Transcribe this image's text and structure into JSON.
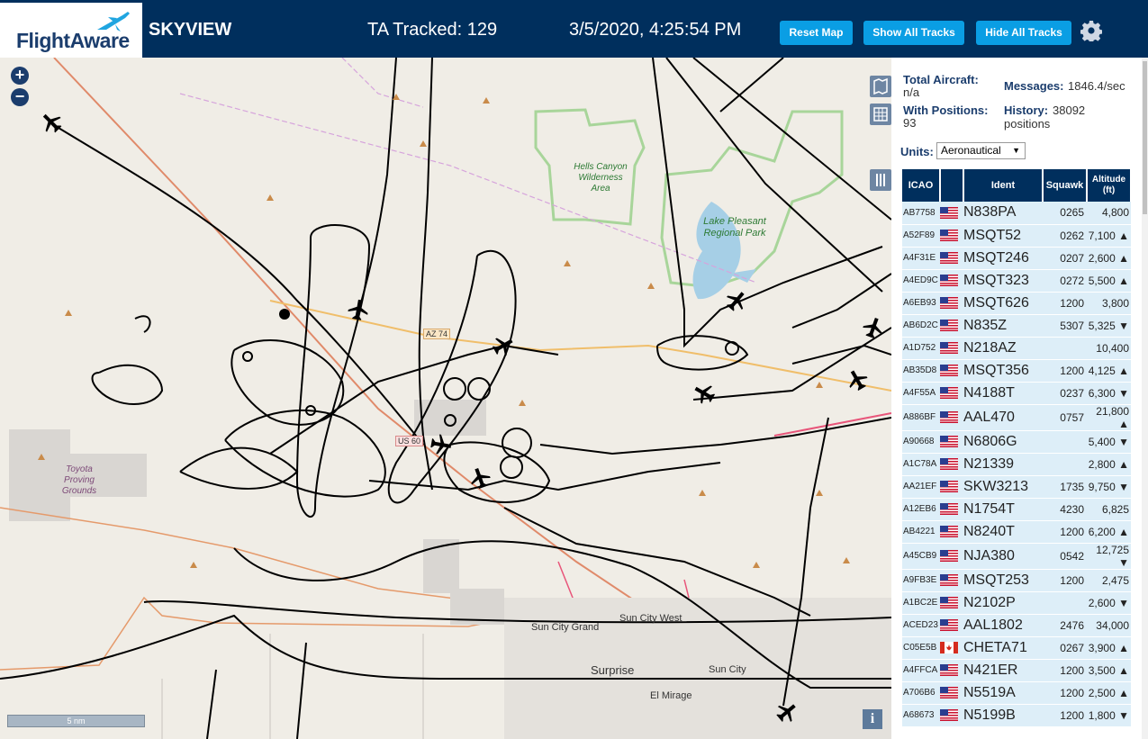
{
  "header": {
    "logo_text": "FlightAware",
    "app_title": "SKYVIEW",
    "ta_tracked": "TA Tracked: 129",
    "clock": "3/5/2020, 4:25:54 PM",
    "buttons": {
      "reset": "Reset Map",
      "show_all": "Show All Tracks",
      "hide_all": "Hide All Tracks"
    },
    "bg_color": "#002f5d",
    "button_color": "#0a9ee4"
  },
  "map": {
    "zoom_in": "+",
    "zoom_out": "−",
    "scale": "5 nm",
    "info": "i",
    "labels": {
      "hells_canyon": "Hells Canyon Wilderness Area",
      "lake_pleasant": "Lake Pleasant Regional Park",
      "toyota": "Toyota Proving Grounds",
      "sun_city_grand": "Sun City Grand",
      "sun_city_west": "Sun City West",
      "surprise": "Surprise",
      "sun_city": "Sun City",
      "el_mirage": "El Mirage",
      "az74": "AZ 74",
      "us60": "US 60"
    }
  },
  "stats": {
    "total_aircraft_label": "Total Aircraft:",
    "total_aircraft": "n/a",
    "messages_label": "Messages:",
    "messages": "1846.4/sec",
    "with_positions_label": "With Positions:",
    "with_positions": "93",
    "history_label": "History:",
    "history": "38092 positions",
    "units_label": "Units:",
    "units_value": "Aeronautical"
  },
  "table": {
    "headers": {
      "icao": "ICAO",
      "ident": "Ident",
      "squawk": "Squawk",
      "altitude": "Altitude (ft)"
    },
    "rows": [
      {
        "icao": "AB7758",
        "flag": "US",
        "ident": "N838PA",
        "squawk": "0265",
        "alt": "4,800"
      },
      {
        "icao": "A52F89",
        "flag": "US",
        "ident": "MSQT52",
        "squawk": "0262",
        "alt": "7,100 ▲"
      },
      {
        "icao": "A4F31E",
        "flag": "US",
        "ident": "MSQT246",
        "squawk": "0207",
        "alt": "2,600 ▲"
      },
      {
        "icao": "A4ED9C",
        "flag": "US",
        "ident": "MSQT323",
        "squawk": "0272",
        "alt": "5,500 ▲"
      },
      {
        "icao": "A6EB93",
        "flag": "US",
        "ident": "MSQT626",
        "squawk": "1200",
        "alt": "3,800"
      },
      {
        "icao": "AB6D2C",
        "flag": "US",
        "ident": "N835Z",
        "squawk": "5307",
        "alt": "5,325 ▼"
      },
      {
        "icao": "A1D752",
        "flag": "US",
        "ident": "N218AZ",
        "squawk": "",
        "alt": "10,400"
      },
      {
        "icao": "AB35D8",
        "flag": "US",
        "ident": "MSQT356",
        "squawk": "1200",
        "alt": "4,125 ▲"
      },
      {
        "icao": "A4F55A",
        "flag": "US",
        "ident": "N4188T",
        "squawk": "0237",
        "alt": "6,300 ▼"
      },
      {
        "icao": "A886BF",
        "flag": "US",
        "ident": "AAL470",
        "squawk": "0757",
        "alt": "21,800 ▲"
      },
      {
        "icao": "A90668",
        "flag": "US",
        "ident": "N6806G",
        "squawk": "",
        "alt": "5,400 ▼"
      },
      {
        "icao": "A1C78A",
        "flag": "US",
        "ident": "N21339",
        "squawk": "",
        "alt": "2,800 ▲"
      },
      {
        "icao": "AA21EF",
        "flag": "US",
        "ident": "SKW3213",
        "squawk": "1735",
        "alt": "9,750 ▼"
      },
      {
        "icao": "A12EB6",
        "flag": "US",
        "ident": "N1754T",
        "squawk": "4230",
        "alt": "6,825"
      },
      {
        "icao": "AB4221",
        "flag": "US",
        "ident": "N8240T",
        "squawk": "1200",
        "alt": "6,200 ▲"
      },
      {
        "icao": "A45CB9",
        "flag": "US",
        "ident": "NJA380",
        "squawk": "0542",
        "alt": "12,725 ▼"
      },
      {
        "icao": "A9FB3E",
        "flag": "US",
        "ident": "MSQT253",
        "squawk": "1200",
        "alt": "2,475"
      },
      {
        "icao": "A1BC2E",
        "flag": "US",
        "ident": "N2102P",
        "squawk": "",
        "alt": "2,600 ▼"
      },
      {
        "icao": "ACED23",
        "flag": "US",
        "ident": "AAL1802",
        "squawk": "2476",
        "alt": "34,000"
      },
      {
        "icao": "C05E5B",
        "flag": "CA",
        "ident": "CHETA71",
        "squawk": "0267",
        "alt": "3,900 ▲"
      },
      {
        "icao": "A4FFCA",
        "flag": "US",
        "ident": "N421ER",
        "squawk": "1200",
        "alt": "3,500 ▲"
      },
      {
        "icao": "A706B6",
        "flag": "US",
        "ident": "N5519A",
        "squawk": "1200",
        "alt": "2,500 ▲"
      },
      {
        "icao": "A68673",
        "flag": "US",
        "ident": "N5199B",
        "squawk": "1200",
        "alt": "1,800 ▼"
      }
    ]
  }
}
